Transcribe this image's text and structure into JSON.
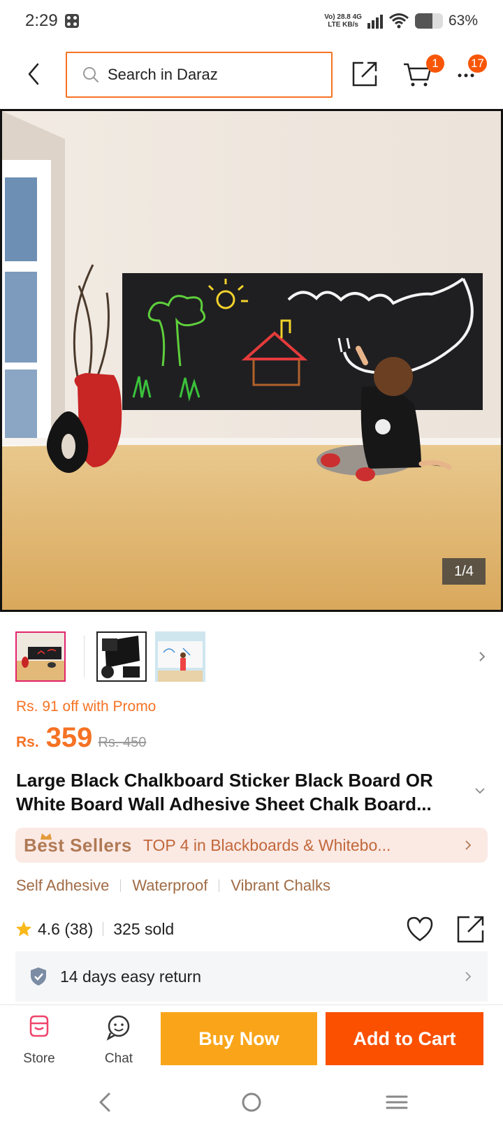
{
  "status_bar": {
    "time": "2:29",
    "net_top": "Vo) 28.8 4G",
    "net_bottom": "LTE KB/s",
    "battery_level": 0.63,
    "battery_pct": "63%"
  },
  "header": {
    "search_placeholder": "Search in Daraz",
    "cart_count": "1",
    "more_count": "17"
  },
  "gallery": {
    "counter": "1/4",
    "thumbnail_count": 3
  },
  "price": {
    "promo": "Rs. 91 off with Promo",
    "currency": "Rs.",
    "current": "359",
    "original": "Rs. 450"
  },
  "product": {
    "title": "Large Black Chalkboard Sticker Black Board OR White Board Wall Adhesive Sheet Chalk Board...",
    "best_sellers_label": "Best Sellers",
    "best_sellers_rank": "TOP 4 in Blackboards & Whitebo...",
    "tags": [
      "Self Adhesive",
      "Waterproof",
      "Vibrant Chalks"
    ],
    "rating": "4.6 (38)",
    "sold": "325 sold",
    "return_policy": "14 days easy return"
  },
  "actions": {
    "store_label": "Store",
    "chat_label": "Chat",
    "buy_now": "Buy Now",
    "add_to_cart": "Add to Cart"
  },
  "colors": {
    "accent": "#f57224",
    "buy_now": "#faa519",
    "add_to_cart": "#fa5000"
  }
}
